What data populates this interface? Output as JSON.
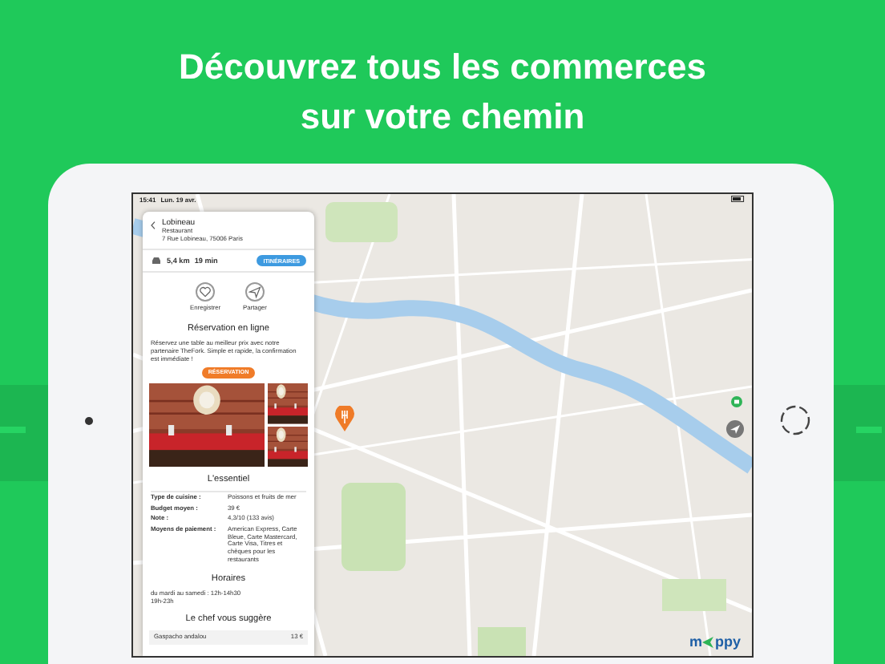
{
  "headline": [
    "Découvrez tous les commerces",
    "sur votre chemin"
  ],
  "status_bar": {
    "time": "15:41",
    "date": "Lun. 19 avr."
  },
  "place": {
    "name": "Lobineau",
    "category": "Restaurant",
    "address": "7 Rue Lobineau, 75006 Paris",
    "distance": "5,4 km",
    "duration": "19 min",
    "route_button": "ITINÉRAIRES",
    "actions": [
      {
        "kind": "save",
        "label": "Enregistrer"
      },
      {
        "kind": "share",
        "label": "Partager"
      }
    ],
    "booking": {
      "title": "Réservation en ligne",
      "text": "Réservez une table au meilleur prix avec notre partenaire TheFork. Simple et rapide, la confirmation est immédiate !",
      "button": "RÉSERVATION"
    },
    "essentials": {
      "title": "L'essentiel",
      "rows": [
        {
          "label": "Type de cuisine :",
          "value": "Poissons et fruits de mer"
        },
        {
          "label": "Budget moyen :",
          "value": "39 €"
        },
        {
          "label": "Note :",
          "value": "4,3/10 (133 avis)"
        },
        {
          "label": "Moyens de paiement :",
          "value": "American Express, Carte Bleue, Carte Mastercard, Carte Visa, Titres et chèques pour les restaurants"
        }
      ]
    },
    "hours": {
      "title": "Horaires",
      "lines": [
        "du mardi au samedi : 12h-14h30",
        "19h-23h"
      ]
    },
    "chef": {
      "title": "Le chef vous suggère",
      "items": [
        {
          "name": "Gaspacho andalou",
          "price": "13 €"
        }
      ]
    }
  },
  "logo": {
    "start": "m",
    "end": "ppy"
  }
}
